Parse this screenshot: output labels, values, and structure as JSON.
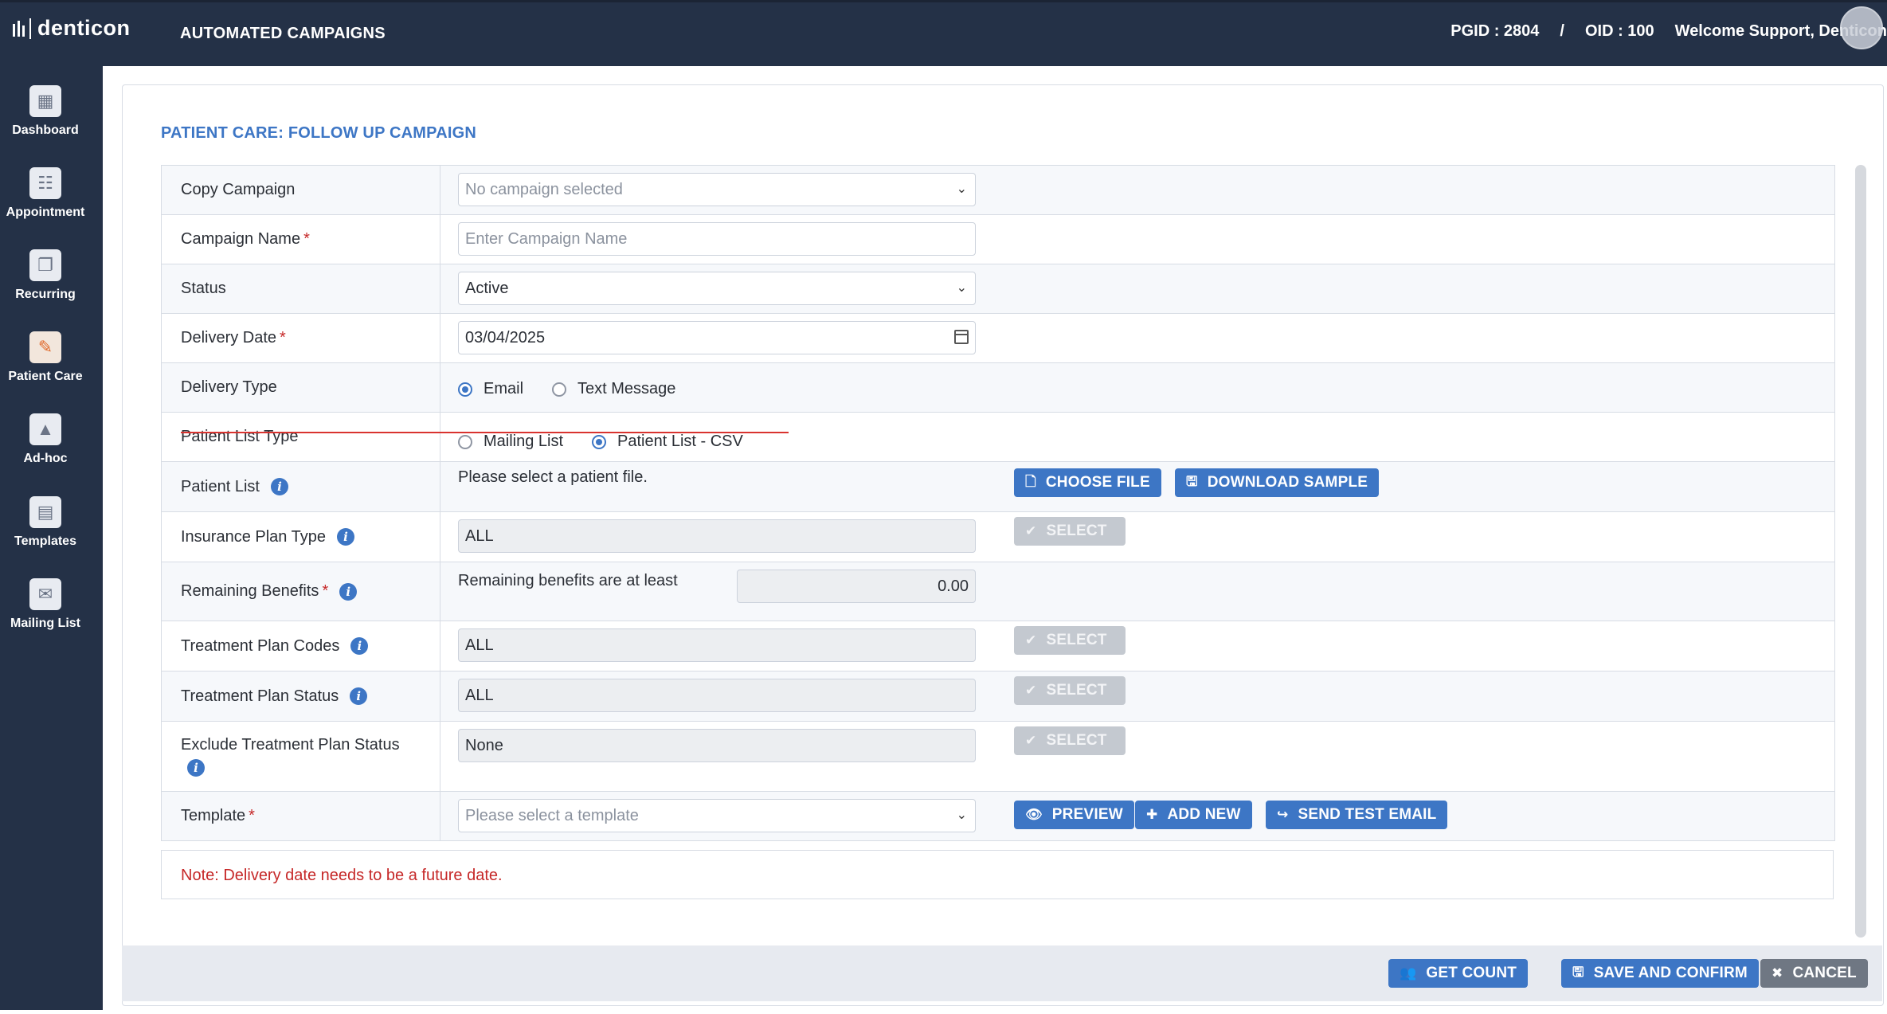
{
  "app": {
    "logo_text": "denticon",
    "title": "AUTOMATED CAMPAIGNS",
    "pgid": "PGID : 2804",
    "separator": "/",
    "oid": "OID : 100",
    "welcome": "Welcome Support, Denticon"
  },
  "sidebar": {
    "items": [
      {
        "label": "Dashboard",
        "icon": "dashboard-icon"
      },
      {
        "label": "Appointment",
        "icon": "appointment-icon"
      },
      {
        "label": "Recurring",
        "icon": "recurring-icon"
      },
      {
        "label": "Patient Care",
        "icon": "patient-care-icon"
      },
      {
        "label": "Ad-hoc",
        "icon": "ad-hoc-icon"
      },
      {
        "label": "Templates",
        "icon": "templates-icon"
      },
      {
        "label": "Mailing List",
        "icon": "mailing-list-icon"
      }
    ]
  },
  "page": {
    "heading": "PATIENT CARE: FOLLOW UP CAMPAIGN"
  },
  "form": {
    "copy_campaign": {
      "label": "Copy Campaign",
      "placeholder": "No campaign selected"
    },
    "campaign_name": {
      "label": "Campaign Name",
      "required": "*",
      "placeholder": "Enter Campaign Name"
    },
    "status": {
      "label": "Status",
      "value": "Active"
    },
    "delivery_date": {
      "label": "Delivery Date",
      "required": "*",
      "value": "03/04/2025"
    },
    "delivery_type": {
      "label": "Delivery Type",
      "options": [
        "Email",
        "Text Message"
      ],
      "selected": "Email"
    },
    "patient_list_type": {
      "label": "Patient List Type",
      "options": [
        "Mailing List",
        "Patient List - CSV"
      ],
      "selected": "Patient List - CSV"
    },
    "patient_list": {
      "label": "Patient List",
      "message": "Please select a patient file.",
      "choose_file": "CHOOSE FILE",
      "download_sample": "DOWNLOAD SAMPLE"
    },
    "insurance_plan_type": {
      "label": "Insurance Plan Type",
      "value": "ALL",
      "select": "SELECT"
    },
    "remaining_benefits": {
      "label": "Remaining Benefits",
      "required": "*",
      "text": "Remaining benefits are at least",
      "value": "0.00"
    },
    "treatment_plan_codes": {
      "label": "Treatment Plan Codes",
      "value": "ALL",
      "select": "SELECT"
    },
    "treatment_plan_status": {
      "label": "Treatment Plan Status",
      "value": "ALL",
      "select": "SELECT"
    },
    "exclude_treatment_plan_status": {
      "label": "Exclude Treatment Plan Status",
      "value": "None",
      "select": "SELECT"
    },
    "template": {
      "label": "Template",
      "required": "*",
      "placeholder": "Please select a template",
      "preview": "PREVIEW",
      "add_new": "ADD NEW",
      "send_test_email": "SEND TEST EMAIL"
    }
  },
  "note": "Note: Delivery date needs to be a future date.",
  "footer": {
    "get_count": "GET COUNT",
    "save_and_confirm": "SAVE AND CONFIRM",
    "cancel": "CANCEL"
  },
  "colors": {
    "nav_bg": "#243147",
    "accent": "#3d76c5",
    "error": "#c62828",
    "annotation": "#d9332f"
  }
}
